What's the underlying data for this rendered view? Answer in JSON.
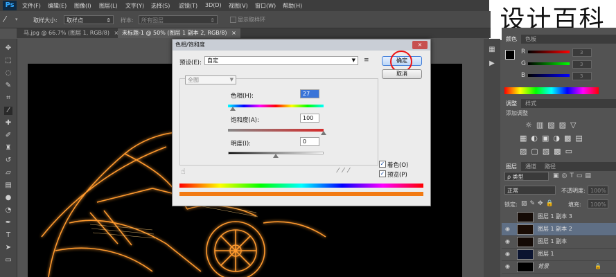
{
  "app": {
    "logo": "Ps"
  },
  "menu": [
    "文件(F)",
    "编辑(E)",
    "图像(I)",
    "图层(L)",
    "文字(Y)",
    "选择(S)",
    "滤镜(T)",
    "3D(D)",
    "视图(V)",
    "窗口(W)",
    "帮助(H)"
  ],
  "options": {
    "sample_size_label": "取样大小:",
    "sample_size_value": "取样点",
    "sample_label": "样本:",
    "sample_value": "所有图层",
    "show_ring": "显示取样环"
  },
  "tabs": [
    {
      "label": "马.jpg @ 66.7% (图层 1, RGB/8)",
      "close": "×"
    },
    {
      "label": "未标题-1 @ 50% (图层 1 副本 2, RGB/8)",
      "close": "×"
    }
  ],
  "watermark": "设计百科",
  "color_panel": {
    "tabs": [
      "颜色",
      "色板"
    ],
    "channels": [
      {
        "label": "R",
        "value": "3"
      },
      {
        "label": "G",
        "value": "3"
      },
      {
        "label": "B",
        "value": "3"
      }
    ]
  },
  "adjust_panel": {
    "tabs": [
      "调整",
      "样式"
    ],
    "heading": "添加调整"
  },
  "layers_panel": {
    "tabs": [
      "图层",
      "通道",
      "路径"
    ],
    "filter": "ρ 类型",
    "blend_mode": "正常",
    "opacity_label": "不透明度:",
    "opacity_value": "100%",
    "lock_label": "锁定:",
    "fill_label": "填充:",
    "fill_value": "100%",
    "layers": [
      {
        "name": "图层 1 副本 3",
        "visible": false,
        "selected": false
      },
      {
        "name": "图层 1 副本 2",
        "visible": true,
        "selected": true
      },
      {
        "name": "图层 1 副本",
        "visible": true,
        "selected": false
      },
      {
        "name": "图层 1",
        "visible": true,
        "selected": false
      },
      {
        "name": "背景",
        "visible": true,
        "selected": false,
        "locked": true
      }
    ]
  },
  "dialog": {
    "title": "色相/饱和度",
    "close": "×",
    "preset_label": "预设(E):",
    "preset_value": "自定",
    "ok_label": "确定",
    "cancel_label": "取消",
    "channel_value": "全图",
    "hue_label": "色相(H):",
    "hue_value": "27",
    "hue_slider": 0.05,
    "saturation_label": "饱和度(A):",
    "saturation_value": "100",
    "saturation_slider": 1.0,
    "lightness_label": "明度(I):",
    "lightness_value": "0",
    "lightness_slider": 0.5,
    "colorize_label": "着色(O)",
    "colorize_checked": true,
    "preview_label": "预览(P)",
    "preview_checked": true
  }
}
